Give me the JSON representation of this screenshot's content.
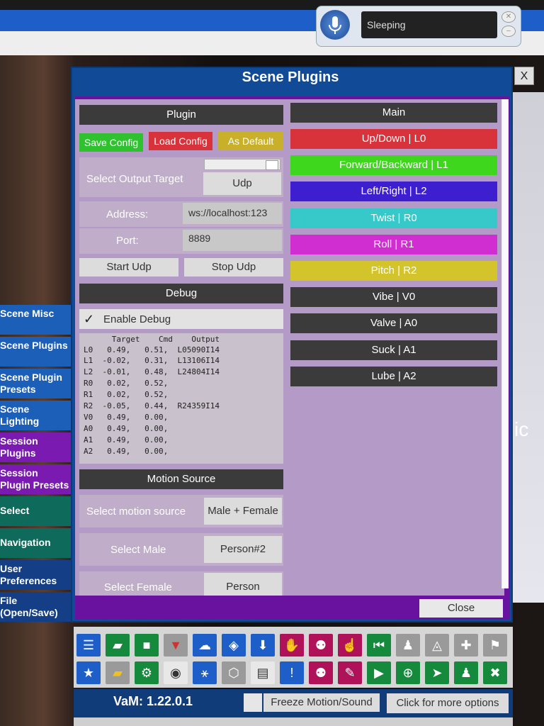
{
  "speech": {
    "status": "Sleeping"
  },
  "panel": {
    "title": "Scene Plugins",
    "close_x": "X",
    "close_button": "Close"
  },
  "plugin": {
    "header": "Plugin",
    "save_config": "Save Config",
    "load_config": "Load Config",
    "as_default": "As Default",
    "select_output_label": "Select Output Target",
    "output_value": "Udp",
    "address_label": "Address:",
    "address_value": "ws://localhost:123",
    "port_label": "Port:",
    "port_value": "8889",
    "start": "Start Udp",
    "stop": "Stop Udp"
  },
  "debug": {
    "header": "Debug",
    "checkbox_mark": "✓",
    "enable_label": "Enable Debug",
    "columns": "      Target    Cmd    Output",
    "rows": [
      "L0   0.49,   0.51,  L05090I14",
      "L1  -0.02,   0.31,  L13106I14",
      "L2  -0.01,   0.48,  L24804I14",
      "R0   0.02,   0.52,",
      "R1   0.02,   0.52,",
      "R2  -0.05,   0.44,  R24359I14",
      "V0   0.49,   0.00,",
      "A0   0.49,   0.00,",
      "A1   0.49,   0.00,",
      "A2   0.49,   0.00,"
    ]
  },
  "motion": {
    "header": "Motion Source",
    "select_source_label": "Select motion source",
    "source_value": "Male + Female",
    "select_male_label": "Select Male",
    "male_value": "Person#2",
    "select_female_label": "Select Female",
    "female_value": "Person"
  },
  "main": {
    "header": "Main",
    "axes": [
      {
        "label": "Up/Down | L0",
        "color": "#d8323a"
      },
      {
        "label": "Forward/Backward | L1",
        "color": "#3fd61e"
      },
      {
        "label": "Left/Right | L2",
        "color": "#3d1fd0"
      },
      {
        "label": "Twist | R0",
        "color": "#37c9c9"
      },
      {
        "label": "Roll | R1",
        "color": "#d12ed2"
      },
      {
        "label": "Pitch | R2",
        "color": "#d2c42a"
      },
      {
        "label": "Vibe | V0",
        "color": "#3b3b3b"
      },
      {
        "label": "Valve | A0",
        "color": "#3b3b3b"
      },
      {
        "label": "Suck | A1",
        "color": "#3b3b3b"
      },
      {
        "label": "Lube | A2",
        "color": "#3b3b3b"
      }
    ]
  },
  "sidebar": {
    "items": [
      {
        "label": "Scene Misc"
      },
      {
        "label": "Scene Plugins"
      },
      {
        "label": "Scene Plugin Presets"
      },
      {
        "label": "Scene Lighting"
      },
      {
        "label": "Session Plugins"
      },
      {
        "label": "Session Plugin Presets"
      },
      {
        "label": "Select"
      },
      {
        "label": "Navigation"
      },
      {
        "label": "User Preferences"
      },
      {
        "label": "File (Open/Save)"
      }
    ]
  },
  "background_text": {
    "partial": "ic"
  },
  "status": {
    "version": "VaM: 1.22.0.1",
    "freeze": "Freeze Motion/Sound",
    "more": "Click for more options"
  },
  "colors": {
    "panel_blue": "#114a96",
    "panel_purple": "#6a12a0",
    "lilac": "#b49ac6"
  }
}
